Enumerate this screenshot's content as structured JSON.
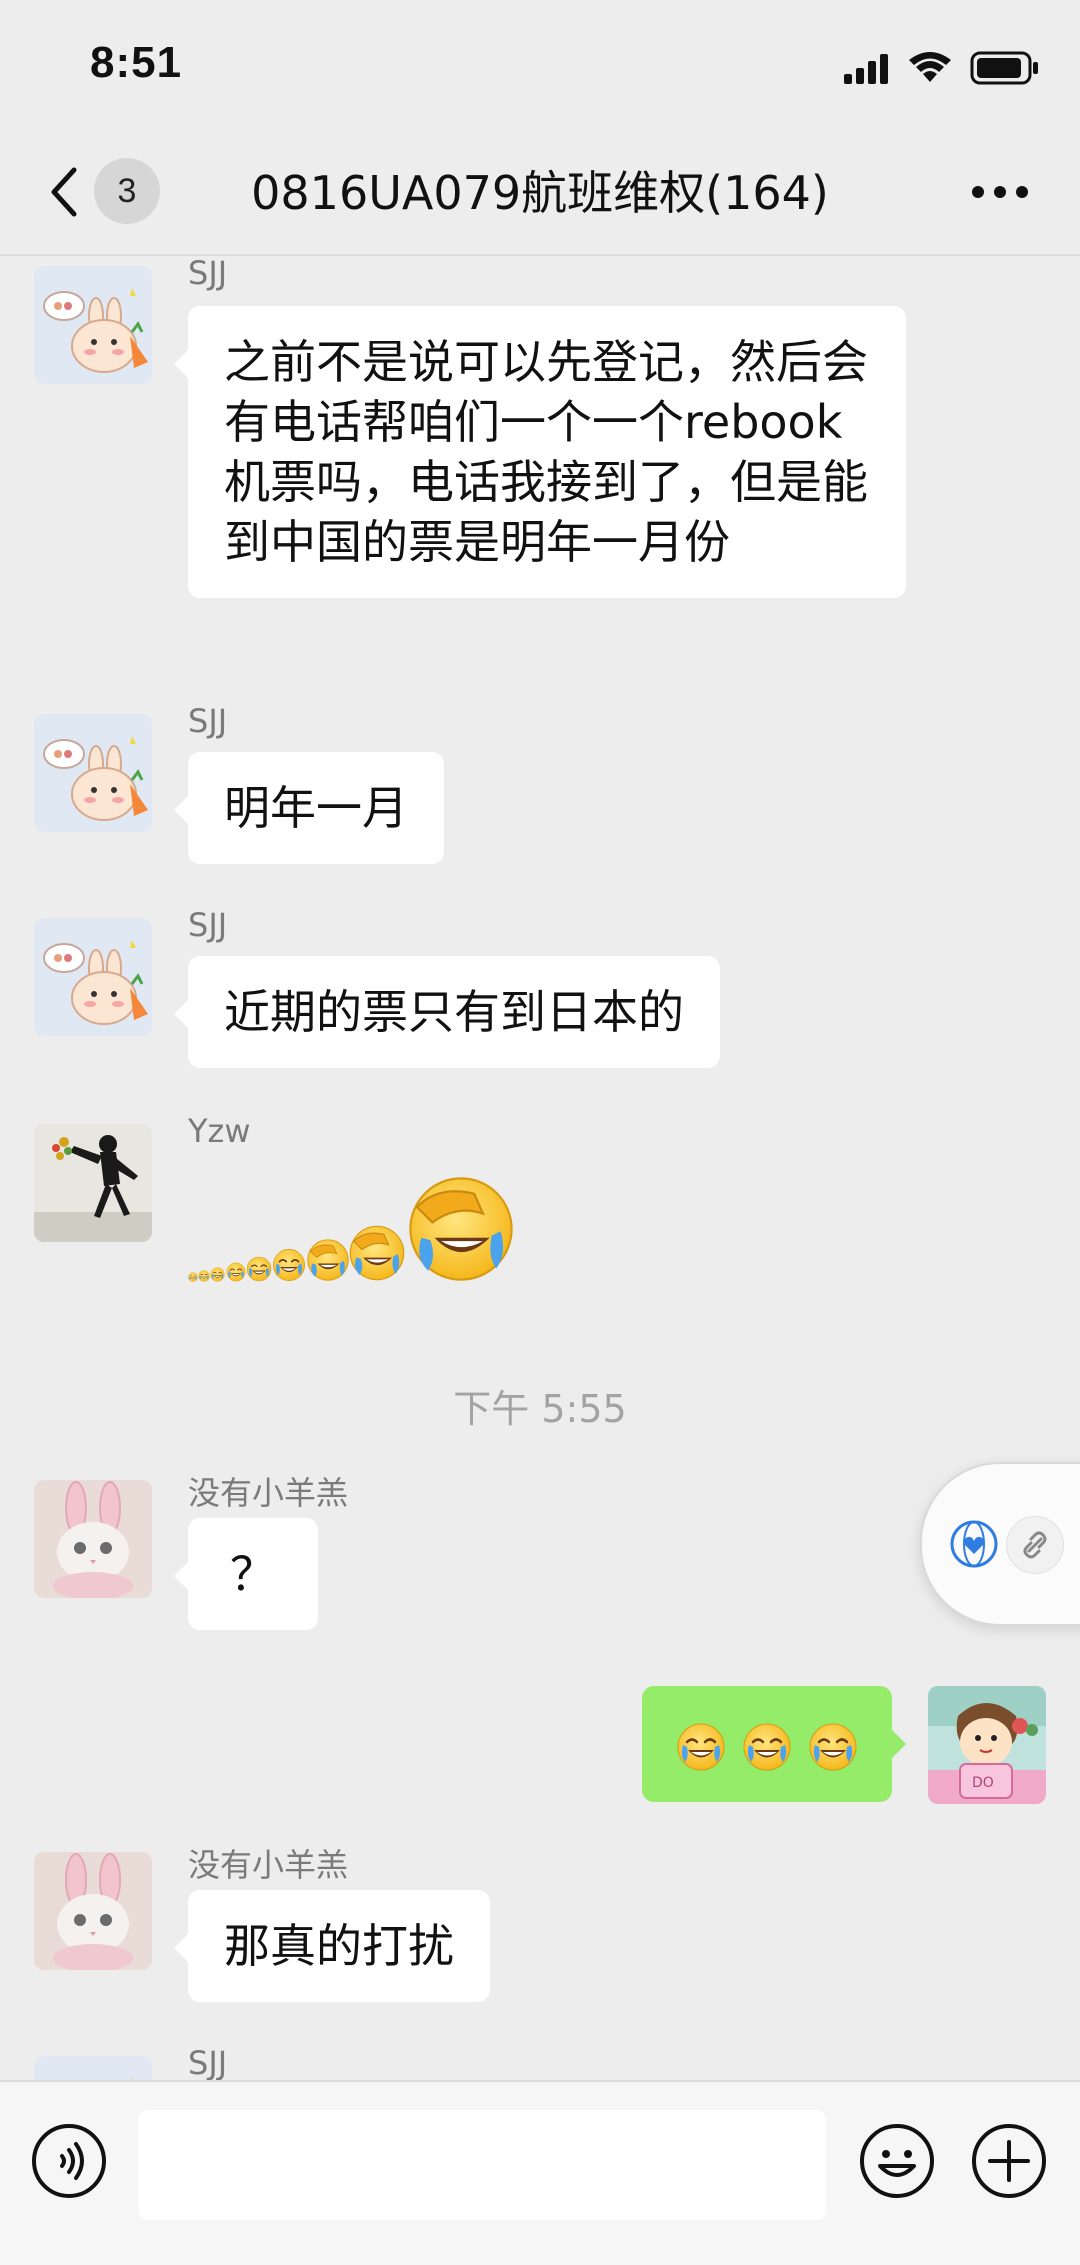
{
  "status_bar": {
    "time": "8:51"
  },
  "header": {
    "unread_count": "3",
    "title": "0816UA079航班维权(164)"
  },
  "messages": [
    {
      "sender": "SJJ",
      "text": "之前不是说可以先登记，然后会有电话帮咱们一个一个rebook机票吗，电话我接到了，但是能到中国的票是明年一月份"
    },
    {
      "sender": "SJJ",
      "text": "明年一月"
    },
    {
      "sender": "SJJ",
      "text": "近期的票只有到日本的"
    },
    {
      "sender": "Yzw",
      "sticker": "facepalm-crying-emoji-sequence"
    },
    {
      "sender": "没有小羊羔",
      "text": "？"
    },
    {
      "sender": "self",
      "emoji_count": 3
    },
    {
      "sender": "没有小羊羔",
      "text": "那真的打扰"
    },
    {
      "sender": "SJJ"
    }
  ],
  "time_divider": "下午 5:55",
  "input": {
    "value": "",
    "placeholder": ""
  },
  "colors": {
    "background": "#ededed",
    "self_bubble": "#95ec69",
    "other_bubble": "#ffffff",
    "input_bar": "#f6f6f6"
  },
  "icons": {
    "back": "chevron-left-icon",
    "more": "ellipsis-icon",
    "voice": "voice-icon",
    "emoji": "emoji-icon",
    "plus": "plus-icon",
    "floating": [
      "heart-globe-icon",
      "link-icon"
    ]
  }
}
